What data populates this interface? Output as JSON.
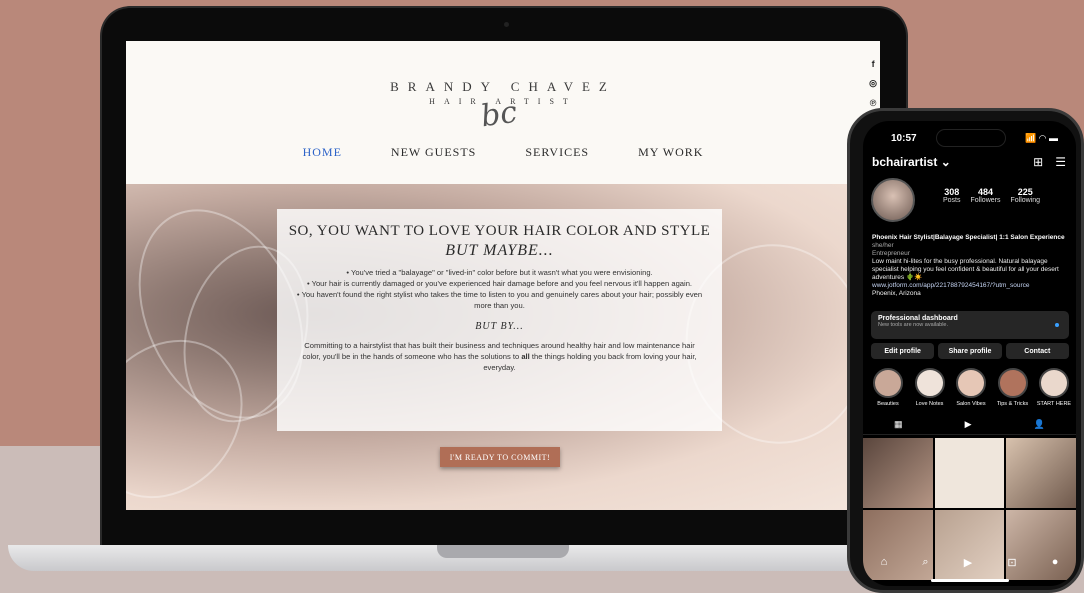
{
  "website": {
    "logo": {
      "name": "BRANDY CHAVEZ",
      "tagline": "HAIR ARTIST",
      "script": "bc"
    },
    "social": {
      "facebook": "f",
      "instagram": "◎",
      "pinterest": "℗"
    },
    "nav": [
      {
        "label": "HOME",
        "active": true
      },
      {
        "label": "NEW GUESTS",
        "active": false
      },
      {
        "label": "SERVICES",
        "active": false
      },
      {
        "label": "MY WORK",
        "active": false
      }
    ],
    "hero": {
      "headline": "SO, YOU WANT TO LOVE YOUR HAIR COLOR AND STYLE",
      "subheadline": "BUT MAYBE...",
      "bullets": [
        "You've tried a \"balayage\" or \"lived-in\" color before but it wasn't what you were envisioning.",
        "Your hair is currently damaged or you've experienced hair damage before and you feel nervous it'll happen again.",
        "You haven't found the right stylist who takes the time to listen to you and genuinely cares about your hair; possibly even more than you."
      ],
      "but_by": "BUT BY...",
      "body_before": "Committing to a hairstylist that has built their business and techniques around healthy hair and low maintenance hair color, you'll be in the hands of someone who has the solutions to",
      "body_bold": "all",
      "body_after": "the things holding you back from loving your hair, everyday.",
      "cta": "I'M READY TO COMMIT!"
    }
  },
  "instagram": {
    "time": "10:57",
    "status_icons": "📶 ◠ ▬",
    "handle": "bchairartist ⌄",
    "stats": [
      {
        "value": "308",
        "label": "Posts"
      },
      {
        "value": "484",
        "label": "Followers"
      },
      {
        "value": "225",
        "label": "Following"
      }
    ],
    "bio": {
      "name": "Phoenix Hair Stylist|Balayage Specialist| 1:1 Salon Experience",
      "pronouns": "she/her",
      "category": "Entrepreneur",
      "text": "Low maint hi-lites for the busy professional. Natural balayage specialist helping you feel confident & beautiful for all your desert adventures 🌵☀️",
      "link": "www.jotform.com/app/221788792454167/?utm_source",
      "location": "Phoenix, Arizona"
    },
    "dashboard": {
      "title": "Professional dashboard",
      "subtitle": "New tools are now available."
    },
    "buttons": [
      "Edit profile",
      "Share profile",
      "Contact"
    ],
    "highlights": [
      {
        "label": "Beauties",
        "color": "#c9a898"
      },
      {
        "label": "Love Notes",
        "color": "#efe3da"
      },
      {
        "label": "Salon Vibes",
        "color": "#e6c7b6"
      },
      {
        "label": "Tips & Tricks",
        "color": "#b0735d"
      },
      {
        "label": "START HERE",
        "color": "#ead8cc"
      }
    ],
    "grid_tabs": [
      "▦",
      "▶",
      "👤"
    ],
    "posts": [
      {
        "color": "#7a5d51"
      },
      {
        "color": "#efe6dc"
      },
      {
        "color": "#9a8070"
      },
      {
        "color": "#a28372"
      },
      {
        "color": "#b8a190"
      },
      {
        "color": "#cdb6a7"
      }
    ],
    "nav_icons": [
      "⌂",
      "⌕",
      "▶",
      "⊡",
      "●"
    ]
  }
}
